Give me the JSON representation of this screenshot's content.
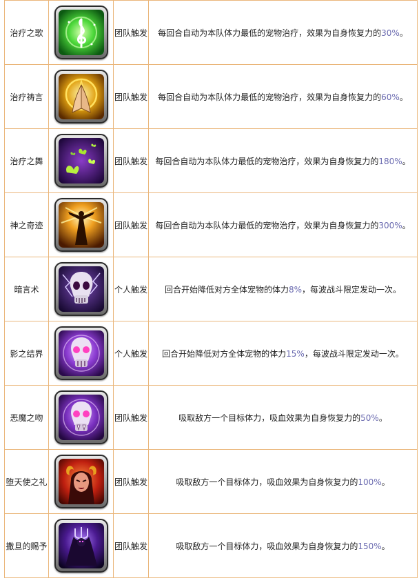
{
  "skills": [
    {
      "name": "治疗之歌",
      "icon": "treble-clef-icon",
      "trigger": "团队触发",
      "desc_before": "每回合自动为本队体力最低的宠物治疗，效果为自身恢复力的",
      "percent": "30%",
      "desc_after": "。"
    },
    {
      "name": "治疗祷言",
      "icon": "praying-hands-icon",
      "trigger": "团队触发",
      "desc_before": "每回合自动为本队体力最低的宠物治疗，效果为自身恢复力的",
      "percent": "60%",
      "desc_after": "。"
    },
    {
      "name": "治疗之舞",
      "icon": "butterflies-icon",
      "trigger": "团队触发",
      "desc_before": "每回合自动为本队体力最低的宠物治疗，效果为自身恢复力的",
      "percent": "180%",
      "desc_after": "。"
    },
    {
      "name": "神之奇迹",
      "icon": "divine-figure-icon",
      "trigger": "团队触发",
      "desc_before": "每回合自动为本队体力最低的宠物治疗，效果为自身恢复力的",
      "percent": "300%",
      "desc_after": "。"
    },
    {
      "name": "暗言术",
      "icon": "lightning-skull-icon",
      "trigger": "个人触发",
      "desc_before": "回合开始降低对方全体宠物的体力",
      "percent": "8%",
      "desc_after": "，每波战斗限定发动一次。"
    },
    {
      "name": "影之结界",
      "icon": "skull-orb-icon",
      "trigger": "个人触发",
      "desc_before": "回合开始降低对方全体宠物的体力",
      "percent": "15%",
      "desc_after": "，每波战斗限定发动一次。"
    },
    {
      "name": "恶魔之吻",
      "icon": "vampire-skull-icon",
      "trigger": "团队触发",
      "desc_before": "吸取敌方一个目标体力，吸血效果为自身恢复力的",
      "percent": "50%",
      "desc_after": "。"
    },
    {
      "name": "堕天使之礼",
      "icon": "horned-angel-icon",
      "trigger": "团队触发",
      "desc_before": "吸取敌方一个目标体力，吸血效果为自身恢复力的",
      "percent": "100%",
      "desc_after": "。"
    },
    {
      "name": "撒旦的赐予",
      "icon": "trident-demon-icon",
      "trigger": "团队触发",
      "desc_before": "吸取敌方一个目标体力，吸血效果为自身恢复力的",
      "percent": "150%",
      "desc_after": "。"
    }
  ],
  "colors": {
    "border": "#eab67a",
    "percent_text": "#6b6bb0"
  }
}
